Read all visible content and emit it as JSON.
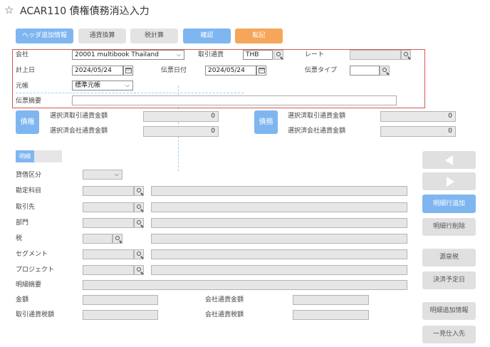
{
  "header": {
    "title": "ACAR110 債権債務消込入力"
  },
  "toolbar": {
    "header_info": "ヘッダ追加情報",
    "currency_convert": "通貨換算",
    "tax_calc": "税計算",
    "confirm": "確認",
    "post": "転記"
  },
  "header_form": {
    "company_label": "会社",
    "company_value": "20001 multibook Thailand",
    "txn_currency_label": "取引通貨",
    "txn_currency_value": "THB",
    "rate_label": "レート",
    "rate_value": "",
    "posting_date_label": "計上日",
    "posting_date_value": "2024/05/24",
    "slip_date_label": "伝票日付",
    "slip_date_value": "2024/05/24",
    "slip_type_label": "伝票タイプ",
    "slip_type_value": "",
    "ledger_label": "元帳",
    "ledger_value": "標準元帳",
    "slip_memo_label": "伝票摘要",
    "slip_memo_value": ""
  },
  "summary": {
    "receivable": {
      "badge": "債権",
      "sel_txn_label": "選択済取引通貨金額",
      "sel_txn_value": "0",
      "sel_company_label": "選択済会社通貨金額",
      "sel_company_value": "0"
    },
    "payable": {
      "badge": "債務",
      "sel_txn_label": "選択済取引通貨金額",
      "sel_txn_value": "0",
      "sel_company_label": "選択済会社通貨金額",
      "sel_company_value": "0"
    }
  },
  "detail": {
    "tab_label": "明細",
    "fields": {
      "debit_credit": "貸借区分",
      "account": "勘定科目",
      "partner": "取引先",
      "department": "部門",
      "tax": "税",
      "segment": "セグメント",
      "project": "プロジェクト",
      "line_memo": "明細摘要",
      "amount": "金額",
      "company_currency_amount": "会社通貨金額",
      "txn_tax_amount": "取引通貨税額",
      "company_currency_tax": "会社通貨税額"
    }
  },
  "side_buttons": {
    "add_line": "明細行追加",
    "delete_line": "明細行削除",
    "withholding_tax": "源泉税",
    "settlement_date": "決済予定日",
    "line_info": "明細追加情報",
    "bulk_vendor": "一見仕入先"
  },
  "colors": {
    "accent_blue": "#7fb6f0",
    "post_orange": "#f5a65b",
    "highlight_red": "#d85555"
  }
}
